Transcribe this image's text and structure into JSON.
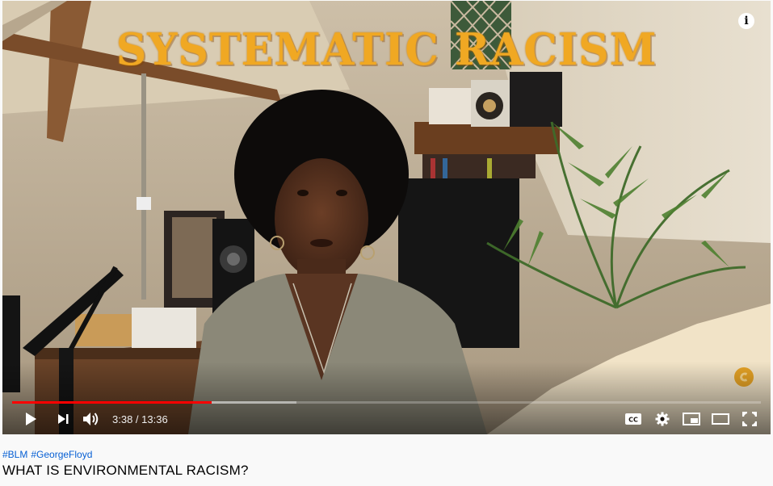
{
  "video": {
    "overlay_title": "SYSTEMATIC RACISM",
    "info_icon": "info-icon",
    "watermark_icon": "channel-watermark-icon",
    "progress_fraction": 0.266,
    "buffered_fraction": 0.38,
    "accent_color": "#ff0000",
    "overlay_title_color": "#f0a823"
  },
  "controls": {
    "current_time": "3:38",
    "separator": " / ",
    "duration": "13:36",
    "left_icons": [
      "play-icon",
      "next-icon",
      "volume-icon"
    ],
    "right_icons": [
      "subtitles-cc-icon",
      "settings-gear-icon",
      "miniplayer-icon",
      "theater-mode-icon",
      "fullscreen-icon"
    ]
  },
  "below": {
    "hashtags": [
      "#BLM",
      "#GeorgeFloyd"
    ],
    "title": "WHAT IS ENVIRONMENTAL RACISM?"
  }
}
